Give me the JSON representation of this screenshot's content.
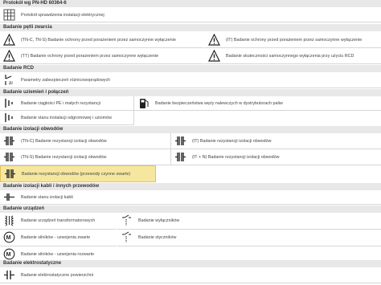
{
  "header": {
    "title": "Protokół wg PN-HD 60364-6",
    "item": "Protokół sprawdzenia instalacji elektrycznej"
  },
  "sections": {
    "zwarcia": {
      "title": "Badanie pętli zwarcia",
      "items": [
        "(TN-C, TN-S) Badanie ochrony przed porażeniem przez samoczynne wyłączenie",
        "(IT) Badanie ochrony przed porażeniem przez samoczynne wyłączenie",
        "(TT) Badanie ochrony przed porażeniem przez samoczynne wyłączenie",
        "Badanie skuteczności samoczynnego wyłączenia przy użyciu RCD"
      ]
    },
    "rcd": {
      "title": "Badanie RCD",
      "items": [
        "Parametry zabezpieczeń różnicowoprądowych"
      ]
    },
    "uziemien": {
      "title": "Badanie uziemień i połączeń",
      "items": [
        "Badanie ciągłości PE i małych rezystancji",
        "Badanie bezpieczeństwa węży nalewczych w dystrybutorach paliw",
        "Badanie stanu instalacji odgromowej i uziomów"
      ]
    },
    "izolacji": {
      "title": "Badanie izolacji obwodów",
      "items": [
        "(TN-C) Badanie rezystancji izolacji obwodów",
        "(IT) Badanie rezystancji izolacji obwodów",
        "(TN-S) Badanie rezystancji izolacji obwodów",
        "(IT + N) Badanie rezystancji izolacji obwodów",
        "Badanie rezystancji obwodów (przewody czynne zwarte)"
      ]
    },
    "kabli": {
      "title": "Badanie izolacji kabli i innych przewodów",
      "items": [
        "Badanie stanu izolacji kabli"
      ]
    },
    "urzadzen": {
      "title": "Badanie urządzeń",
      "items": [
        "Badanie urządzeń transformatorowych",
        "Badanie wyłączników",
        "Badanie silników - uzwojenia zwarte",
        "Badanie styczników",
        "Badanie silników - uzwojenia rozwarte"
      ]
    },
    "elektro": {
      "title": "Badanie elektrostatyczne",
      "items": [
        "Badanie elektrostatyczne powierzchni"
      ]
    }
  },
  "icons": [
    "table-icon",
    "warning-icon",
    "rcd-icon",
    "ground-icon",
    "fuel-icon",
    "insulation-icon",
    "cable-icon",
    "transformer-icon",
    "breaker-icon",
    "motor-icon",
    "contactor-icon",
    "static-icon"
  ]
}
